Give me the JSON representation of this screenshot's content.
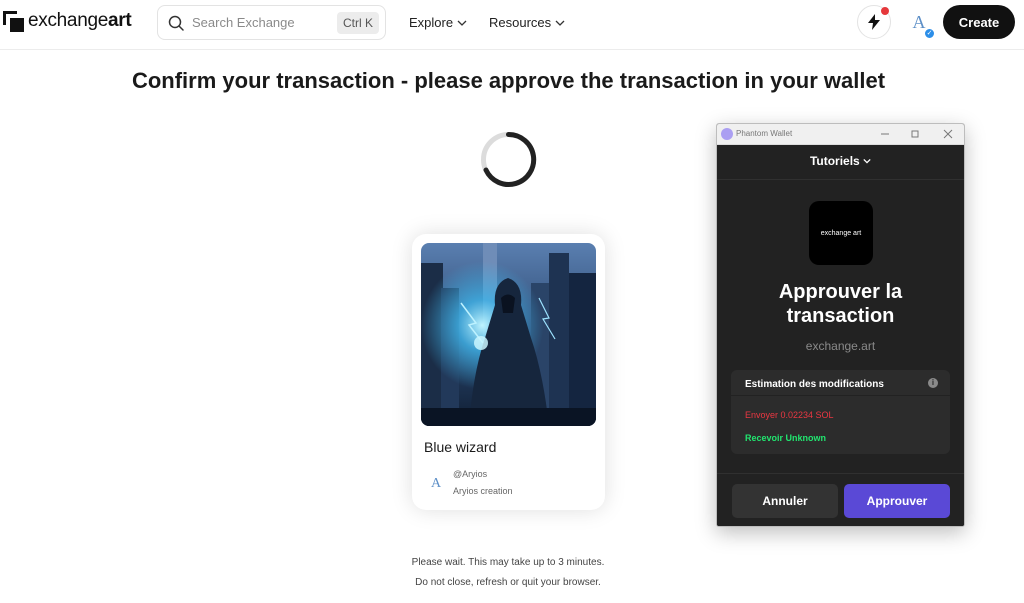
{
  "header": {
    "logo": {
      "prefix": "exchange",
      "suffix": "art"
    },
    "search": {
      "placeholder": "Search Exchange",
      "shortcut": "Ctrl K"
    },
    "nav": [
      {
        "label": "Explore"
      },
      {
        "label": "Resources"
      }
    ],
    "avatar_letter": "A",
    "create_label": "Create"
  },
  "main": {
    "title": "Confirm your transaction - please approve the transaction in your wallet",
    "nft": {
      "title": "Blue wizard",
      "creator_letter": "A",
      "creator_handle": "@Aryios",
      "creator_subtitle": "Aryios creation"
    },
    "wait_line_1": "Please wait. This may take up to 3 minutes.",
    "wait_line_2": "Do not close, refresh or quit your browser."
  },
  "phantom": {
    "window_title": "Phantom Wallet",
    "menu_label": "Tutoriels",
    "site_icon_text": "exchange art",
    "heading_line_1": "Approuver la",
    "heading_line_2": "transaction",
    "origin": "exchange.art",
    "changes_title": "Estimation des modifications",
    "send_text": "Envoyer 0.02234 SOL",
    "receive_text": "Recevoir Unknown",
    "cancel_label": "Annuler",
    "approve_label": "Approuver",
    "colors": {
      "send": "#eb3742",
      "receive": "#21e56f",
      "approve": "#5a49d6"
    }
  }
}
